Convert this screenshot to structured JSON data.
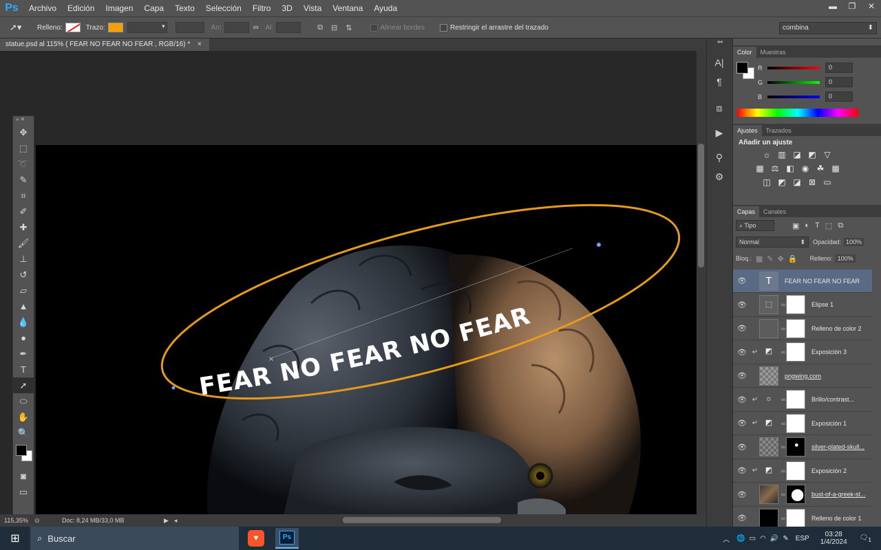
{
  "app": {
    "logo": "Ps"
  },
  "menu": [
    "Archivo",
    "Edición",
    "Imagen",
    "Capa",
    "Texto",
    "Selección",
    "Filtro",
    "3D",
    "Vista",
    "Ventana",
    "Ayuda"
  ],
  "window_controls": {
    "minimize": "▬",
    "restore": "❐",
    "close": "✕"
  },
  "options": {
    "fill_label": "Relleno:",
    "stroke_label": "Trazo:",
    "stroke_color": "#f5a000",
    "width_label": "An:",
    "height_label": "Al:",
    "align_edges": "Alinear bordes",
    "constrain_path": "Restringir el arrastre del trazado",
    "mode_select": "combina"
  },
  "document": {
    "tab_title": "statue.psd al 115% (    FEAR   NO FEAR  NO FEAR , RGB/16) *",
    "tab_close": "×",
    "path_text": "FEAR   NO FEAR   NO FEAR",
    "stroke_color": "#e89a1c"
  },
  "status": {
    "zoom": "115,35%",
    "doc": "Doc: 8,24 MB/33,0 MB"
  },
  "color_panel": {
    "tabs": [
      "Color",
      "Muestras"
    ],
    "channels": [
      {
        "label": "R",
        "value": "0",
        "color": "#e02020"
      },
      {
        "label": "G",
        "value": "0",
        "color": "#20c020"
      },
      {
        "label": "B",
        "value": "0",
        "color": "#2040e0"
      }
    ]
  },
  "adjustments_panel": {
    "tabs": [
      "Ajustes",
      "Trazados"
    ],
    "title": "Añadir un ajuste"
  },
  "layers_panel": {
    "tabs": [
      "Capas",
      "Canales"
    ],
    "filter": "Tipo",
    "blend_mode": "Normal",
    "opacity_label": "Opacidad:",
    "opacity": "100%",
    "lock_label": "Bloq.:",
    "fill_label": "Relleno:",
    "fill": "100%",
    "layers": [
      {
        "name": "FEAR  NO FEAR  NO FEAR",
        "kind": "text",
        "selected": true
      },
      {
        "name": "Elipse 1",
        "kind": "shape"
      },
      {
        "name": "Relleno de color 2",
        "kind": "fill"
      },
      {
        "name": "Exposición 3",
        "kind": "adjust",
        "clip": true
      },
      {
        "name": "pngwing.com",
        "kind": "image",
        "underline": true
      },
      {
        "name": "Brillo/contrast...",
        "kind": "brightness",
        "clip": true
      },
      {
        "name": "Exposición 1",
        "kind": "adjust",
        "clip": true
      },
      {
        "name": "silver-plated-skull...",
        "kind": "skull",
        "underline": true
      },
      {
        "name": "Exposición 2",
        "kind": "adjust",
        "clip": true
      },
      {
        "name": "bust-of-a-greek-st...",
        "kind": "bust",
        "underline": true
      },
      {
        "name": "Relleno de color 1",
        "kind": "fill-black"
      }
    ]
  },
  "taskbar": {
    "search": "Buscar",
    "ps_label": "Ps",
    "lang": "ESP",
    "time": "03:28",
    "date": "1/4/2024",
    "notif": "1"
  }
}
